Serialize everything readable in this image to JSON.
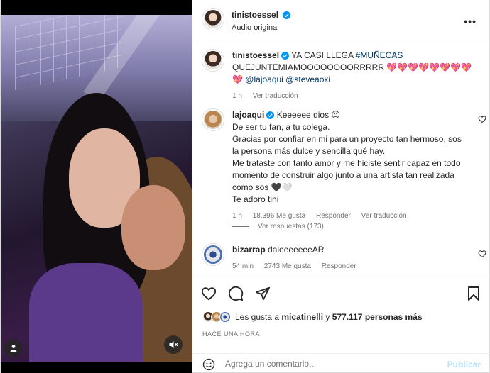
{
  "header": {
    "username": "tinistoessel",
    "subtitle": "Audio original",
    "more_icon": "more-horizontal-icon"
  },
  "caption": {
    "username": "tinistoessel",
    "text": "YA CASI LLEGA",
    "hashtag": "#MUÑECAS",
    "text2": "QUEJUNTEMIAMOOOOOOOORRRRR",
    "hearts": "💖💖💖💖💖💖💖💖💖",
    "mentions": "@lajoaqui @steveaoki",
    "age": "1 h",
    "translate": "Ver traducción"
  },
  "comments": [
    {
      "username": "lajoaqui",
      "first_line": "Keeeeee dios 😍",
      "lines": [
        "De ser tu fan, a tu colega.",
        "Gracias por confiar en mi para un proyecto tan hermoso, sos la persona más dulce y sencilla qué hay.",
        "Me trataste con tanto amor y me hiciste sentir capaz en todo momento de construir algo junto a una artista tan realizada como sos 🖤🤍",
        "Te adoro tini"
      ],
      "age": "1 h",
      "likes": "18.396 Me gusta",
      "reply": "Responder",
      "translate": "Ver traducción",
      "view_replies": "Ver respuestas (173)"
    },
    {
      "username": "bizarrap",
      "text": "daleeeeeeeAR",
      "age": "54 min",
      "likes": "2743 Me gusta",
      "reply": "Responder"
    }
  ],
  "likes_line": {
    "prefix": "Les gusta a",
    "user": "micatinelli",
    "connector": "y",
    "count": "577.117 personas más"
  },
  "timestamp": "HACE UNA HORA",
  "composer": {
    "placeholder": "Agrega un comentario...",
    "post_label": "Publicar"
  },
  "colors": {
    "verified": "#0095f6",
    "link": "#00376b",
    "heart": "#ed4956",
    "secondary": "#737373",
    "post_disabled": "#b2dffc"
  }
}
